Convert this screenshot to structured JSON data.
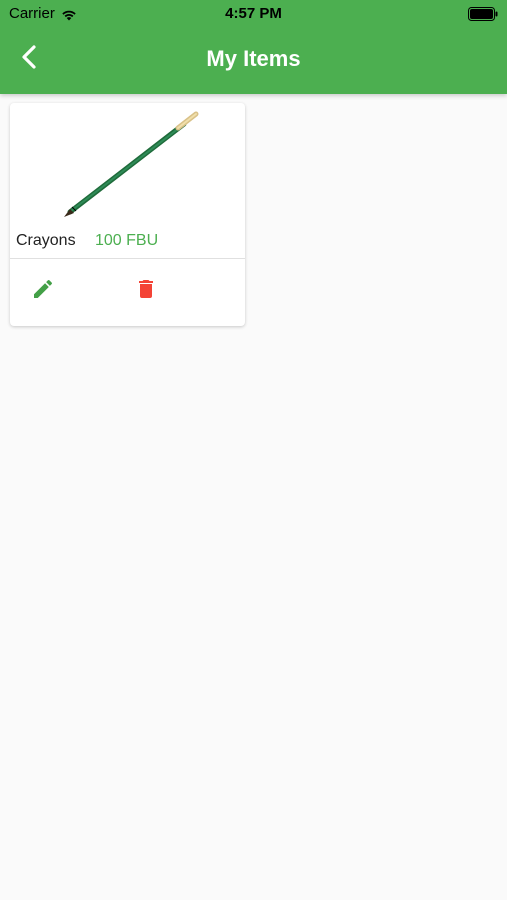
{
  "status_bar": {
    "carrier": "Carrier",
    "time": "4:57 PM",
    "wifi_icon": "wifi-icon",
    "battery_icon": "battery-icon"
  },
  "header": {
    "back_icon": "chevron-left-icon",
    "title": "My Items",
    "background_color": "#4caf50",
    "title_color": "#ffffff"
  },
  "items": [
    {
      "image": "pencil-image",
      "name": "Crayons",
      "price": "100 FBU",
      "price_color": "#4caf50",
      "edit_icon": "pencil-icon",
      "edit_color": "#43a047",
      "delete_icon": "trash-icon",
      "delete_color": "#f44336"
    }
  ]
}
